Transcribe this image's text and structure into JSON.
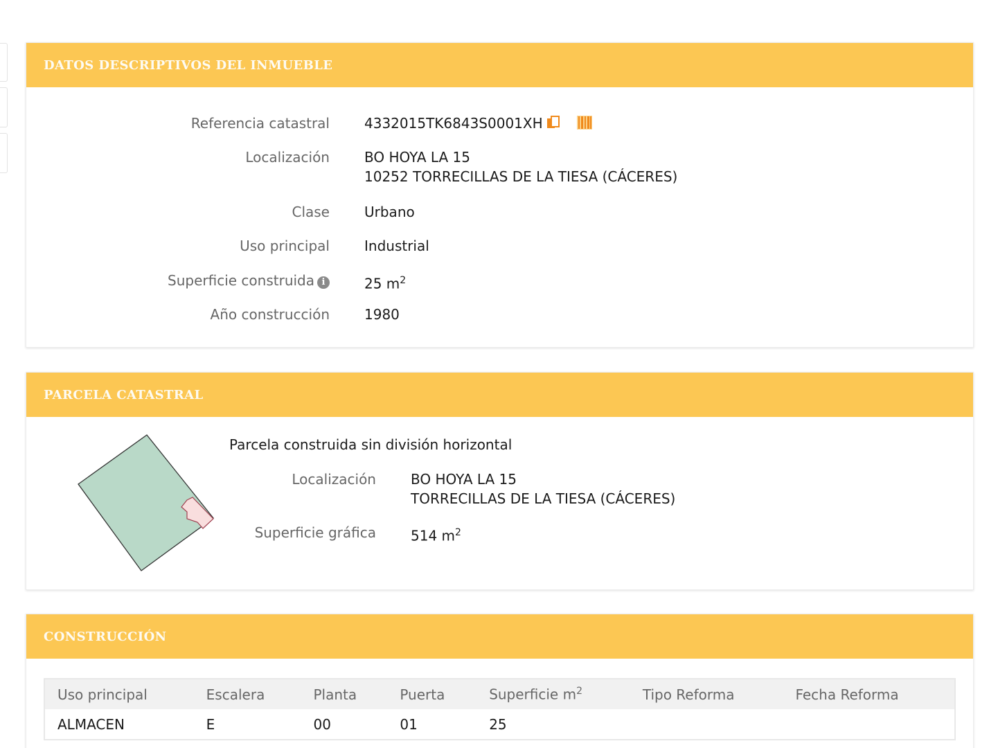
{
  "inmueble": {
    "title": "DATOS DESCRIPTIVOS DEL INMUEBLE",
    "referencia_label": "Referencia catastral",
    "referencia_value": "4332015TK6843S0001XH",
    "localizacion_label": "Localización",
    "localizacion_line1": "BO HOYA LA 15",
    "localizacion_line2": "10252 TORRECILLAS DE LA TIESA (CÁCERES)",
    "clase_label": "Clase",
    "clase_value": "Urbano",
    "uso_label": "Uso principal",
    "uso_value": "Industrial",
    "superficie_label": "Superficie construida",
    "superficie_value": "25 m",
    "superficie_exp": "2",
    "anio_label": "Año construcción",
    "anio_value": "1980"
  },
  "parcela": {
    "title": "PARCELA CATASTRAL",
    "subtitle": "Parcela construida sin división horizontal",
    "localizacion_label": "Localización",
    "localizacion_line1": "BO HOYA LA 15",
    "localizacion_line2": "TORRECILLAS DE LA TIESA (CÁCERES)",
    "superficie_label": "Superficie gráfica",
    "superficie_value": "514 m",
    "superficie_exp": "2"
  },
  "construccion": {
    "title": "CONSTRUCCIÓN",
    "headers": [
      "Uso principal",
      "Escalera",
      "Planta",
      "Puerta",
      "Superficie m",
      "Tipo Reforma",
      "Fecha Reforma"
    ],
    "header_exp": "2",
    "rows": [
      [
        "ALMACEN",
        "E",
        "00",
        "01",
        "25",
        "",
        ""
      ]
    ]
  },
  "colors": {
    "header_bg": "#fcc753",
    "parcel_fill": "#b9d9c8",
    "building_fill": "#f9dede",
    "icon_orange": "#f08a1c"
  }
}
